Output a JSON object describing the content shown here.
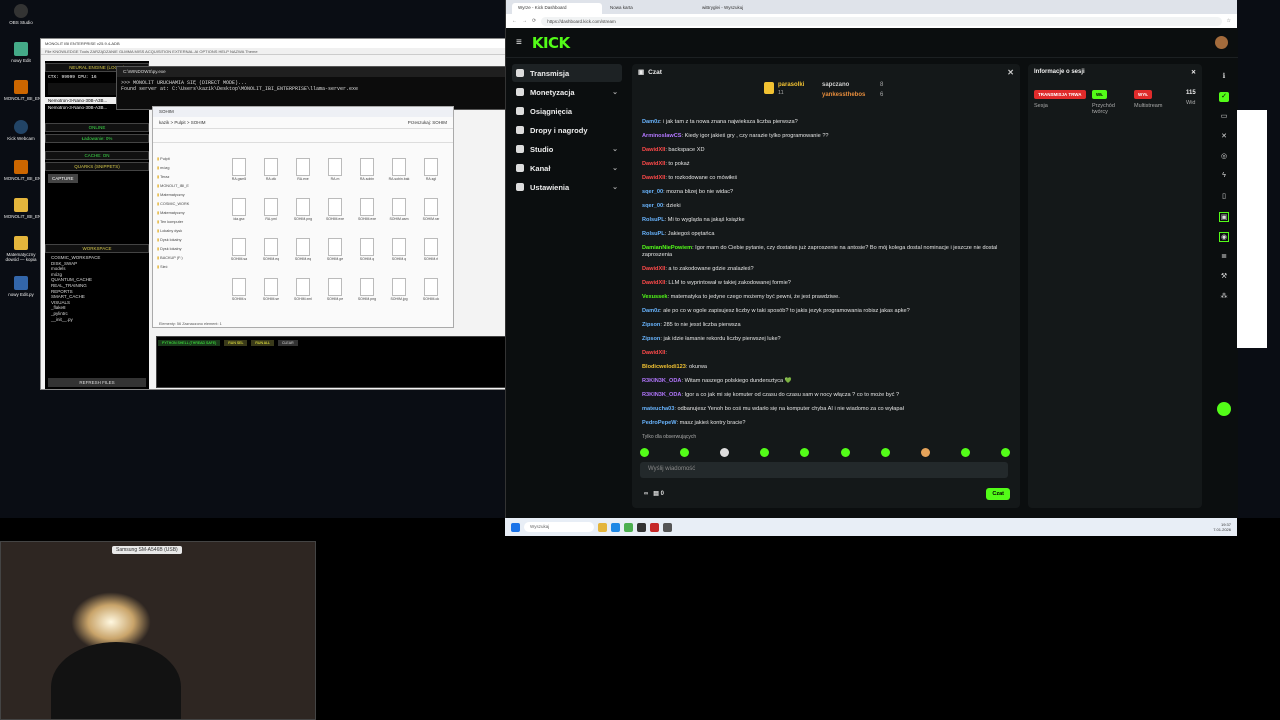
{
  "desktop": {
    "icons": [
      "OBS Studio",
      "nowy Edit",
      "MONOLIT_IBI_EN...",
      "Kick Webcam",
      "MONOLIT_IBI_EN...",
      "MONOLIT_IBI_EN...",
      "Matematyczny dowód — kopia",
      "nowy Edit.py"
    ]
  },
  "monolit": {
    "title": "MONOLIT IBI ENTERPRISE v25.9.4-ADB",
    "menu": "File KNOWLEDGE Tools ZARZĄDZANIE GLMMA MISS ACQUISITION EXTERNAL.AI OPTIONS HELP NAZWA Theme",
    "labels": {
      "engine": "NEURAL ENGINE (LOCAL)",
      "ctx": "CTX: 99999 CPU: 16",
      "m1": "Nemotron-3-Nano-30B-A3B...",
      "m2": "Nemotron-3-Nano-30B-A3B...",
      "online": "ONLINE",
      "loading": "Ładowanie: 0%",
      "cache": "CACHE: ON",
      "quarks": "QUARKS (SNIPPETS)",
      "capture": "CAPTURE",
      "workspace": "WORKSPACE",
      "refresh": "REFRESH FILES"
    },
    "tree": [
      "COSMIC_WORKSPACE",
      "DISK_SWAP",
      "models",
      "mózg",
      "QUANTUM_CACHE",
      "REAL_TRAINING",
      "REPORTS",
      "SMART_CACHE",
      "VISUALS",
      "_flake8",
      "_pylintrc",
      "__init__.py"
    ]
  },
  "cmd": {
    "title": "C:\\WINDOWS\\py.exe",
    "lines": [
      ">>> MONOLIT URUCHAMIA SIĘ (DIRECT MODE)...",
      "Found server at: C:\\Users\\kazik\\Desktop\\MONOLIT_IBI_ENTERPRISE\\llama-server.exe"
    ]
  },
  "explorer": {
    "title": "SOHIM",
    "path": "kazik > Pulpit > SOHIM",
    "search": "Przeszukaj: SOHIM",
    "nav": [
      "Pulpit",
      "mózg",
      "Teraz",
      "MONOLIT_IBI_E",
      "Matematyczny",
      "COSMIC_WORK",
      "Matematyczny",
      "Ten komputer",
      "Lokalny dysk",
      "Dysk lokalny",
      "Dysk lokalny",
      "BACKUP (F:)",
      "Sieć"
    ],
    "files": [
      "RA.gsm5",
      "RA.ctk",
      "RA.exe",
      "RA.m",
      "RA.sobin",
      "RA.sobin.bak",
      "RA.sgl",
      "ida.gsx",
      "RA.yml",
      "SOHIM.png",
      "SOHIM.exe",
      "SOHIM.exe",
      "SOHIM.asm",
      "SOHIM.rar",
      "SOHIM.sa",
      "SOHIM.eq",
      "SOHIM.eq",
      "SOHIM.ge",
      "SOHIM.q",
      "SOHIM.q",
      "SOHIM.rl",
      "SOHIM.s",
      "SOHIM.se",
      "SOHIM.xml",
      "SOHIM.pe",
      "SOHIM.png",
      "SOHIM.jpg",
      "SOHIM.ok"
    ],
    "status": "Elementy: 56   Zaznaczono element: 1"
  },
  "pyshell": {
    "title": "PYTHON SHELL (THREAD SAFE)",
    "btns": [
      "RUN SEL",
      "RUN ALL",
      "CLEAR"
    ]
  },
  "browser": {
    "tabs": [
      "Wyrze - Kick Dashboard",
      "Nowa karta",
      "wiBryglei - Wyszukuj"
    ],
    "url": "https://dashboard.kick.com/stream"
  },
  "kick": {
    "logo": "KICK",
    "nav": [
      {
        "label": "Transmisja",
        "chev": ""
      },
      {
        "label": "Monetyzacja",
        "chev": "⌄"
      },
      {
        "label": "Osiągnięcia",
        "chev": ""
      },
      {
        "label": "Dropy i nagrody",
        "chev": ""
      },
      {
        "label": "Studio",
        "chev": "⌄"
      },
      {
        "label": "Kanał",
        "chev": "⌄"
      },
      {
        "label": "Ustawienia",
        "chev": "⌄"
      }
    ],
    "chat": {
      "title": "Czat",
      "pinned": {
        "l1": "parasolki",
        "l1n": "11",
        "l2": "sapczano",
        "l2n": "8",
        "l3": "yankessthebos",
        "l3n": "6"
      },
      "messages": [
        {
          "u": "Dam0z",
          "c": "#69b5ff",
          "t": "i jak tam z ta nowa znana najwieksza liczba pierwsza?"
        },
        {
          "u": "ArminoslawCS",
          "c": "#b377ff",
          "t": "Kiedy igor jakieś gry , czy narazie tylko programowanie ??"
        },
        {
          "u": "DawidXII",
          "c": "#ff4a4a",
          "t": "backspace XD"
        },
        {
          "u": "DawidXII",
          "c": "#ff4a4a",
          "t": "to pokaż"
        },
        {
          "u": "DawidXII",
          "c": "#ff4a4a",
          "t": "to rozkodowane co mówiłeś"
        },
        {
          "u": "sqer_00",
          "c": "#69b5ff",
          "t": "mozna blizej bo nie widac?"
        },
        {
          "u": "sqer_00",
          "c": "#69b5ff",
          "t": "dzieki"
        },
        {
          "u": "RolsuPL",
          "c": "#69b5ff",
          "t": "Mi to wygląda na jakąś książke"
        },
        {
          "u": "RolsuPL",
          "c": "#69b5ff",
          "t": "Jakiegoś opętańca"
        },
        {
          "u": "DamianNiePowiem",
          "c": "#53fc18",
          "t": "Igor mam do Ciebie pytanie, czy dostales już zaproszenie na antosie? Bo mój kolega dostal nominacje i jeszcze nie dostal zaproszenia"
        },
        {
          "u": "DawidXII",
          "c": "#ff4a4a",
          "t": "a to zakodowane gdzie znalazłeś?"
        },
        {
          "u": "DawidXII",
          "c": "#ff4a4a",
          "t": "LLM to wyprintował w takiej zakodowanej formie?"
        },
        {
          "u": "Vexussek",
          "c": "#53fc18",
          "t": "matematyka to jedyne czego możemy być pewni, że jest prawdziwe."
        },
        {
          "u": "Dam0z",
          "c": "#69b5ff",
          "t": "ale po co w ogole zapisujesz liczby w taki sposób? to jakis jezyk programowania robisz jakas apke?"
        },
        {
          "u": "Zipson",
          "c": "#69b5ff",
          "t": "285 to nie jesst liczba pierwsza"
        },
        {
          "u": "Zipson",
          "c": "#69b5ff",
          "t": "jak idzie łamanie rekordu liczby pierwszej luke?"
        },
        {
          "u": "DawidXII",
          "c": "#ff4a4a",
          "t": ""
        },
        {
          "u": "Blodicwelodi123",
          "c": "#f2c232",
          "t": "okurwa"
        },
        {
          "u": "R3KIN3K_ODA",
          "c": "#b377ff",
          "t": "Witam naszego polskiego dundersztyca 💚"
        },
        {
          "u": "R3KIN3K_ODA",
          "c": "#b377ff",
          "t": "Igor a co jak mi się komuter od czasu do czasu sam w nocy włącza ? co to może być ?"
        },
        {
          "u": "mateucha03",
          "c": "#69b5ff",
          "t": "odbanujesz Yenoh bo coś mu wdarło się na komputer chyba AI i nie wiadomo za co wyłapał"
        },
        {
          "u": "PedroPepeW",
          "c": "#69b5ff",
          "t": "masz jakieś kontry bracie?"
        }
      ],
      "followers": "Tylko dla obserwujących",
      "placeholder": "Wyślij wiadomość",
      "send": "Czat",
      "counter": "0"
    },
    "info": {
      "title": "Informacje o sesji",
      "live": "TRANSMISJA TRWA",
      "live_sub": "Sesja",
      "w1": "WŁ",
      "w1_sub": "Przychód twórcy",
      "w2": "WYŁ",
      "w2_sub": "Multistream",
      "viewers": "115",
      "viewers_sub": "Wid"
    }
  },
  "taskbar": {
    "search": "Wyszukaj",
    "time": "19:37",
    "date": "7.01.2026"
  },
  "cam": {
    "label": "Samsung SM-A546B (USB)"
  },
  "colors": {
    "kick_green": "#53fc18",
    "live_red": "#e02b2b",
    "bg": "#0b0e0f"
  }
}
